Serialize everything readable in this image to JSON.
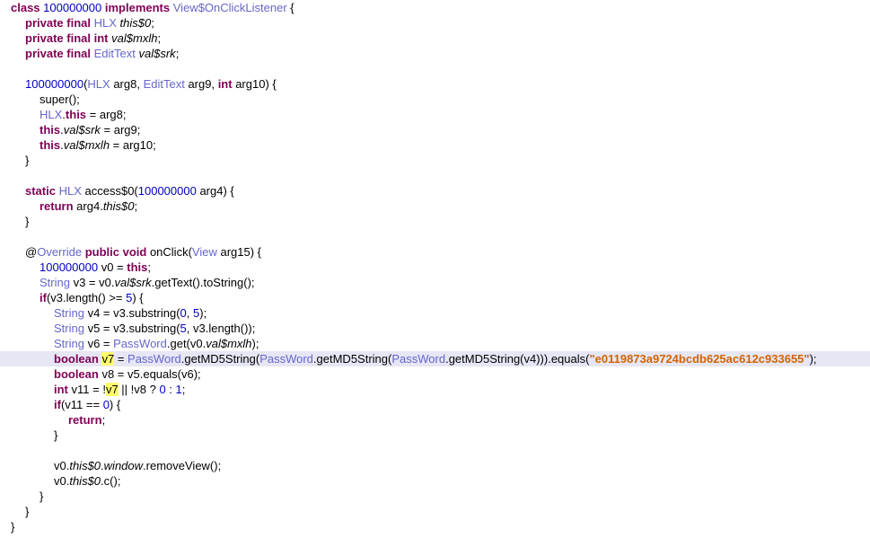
{
  "source": {
    "lines": [
      [
        {
          "t": "class",
          "c": "kw"
        },
        {
          "t": " "
        },
        {
          "t": "100000000",
          "c": "num"
        },
        {
          "t": " "
        },
        {
          "t": "implements",
          "c": "kw"
        },
        {
          "t": " "
        },
        {
          "t": "View$OnClickListener",
          "c": "ty"
        },
        {
          "t": " {"
        }
      ],
      [
        {
          "t": "private",
          "c": "kw"
        },
        {
          "t": " "
        },
        {
          "t": "final",
          "c": "kw"
        },
        {
          "t": " "
        },
        {
          "t": "HLX",
          "c": "ty"
        },
        {
          "t": " "
        },
        {
          "t": "this$0",
          "c": "it"
        },
        {
          "t": ";"
        }
      ],
      [
        {
          "t": "private",
          "c": "kw"
        },
        {
          "t": " "
        },
        {
          "t": "final",
          "c": "kw"
        },
        {
          "t": " "
        },
        {
          "t": "int",
          "c": "kw"
        },
        {
          "t": " "
        },
        {
          "t": "val$mxlh",
          "c": "it"
        },
        {
          "t": ";"
        }
      ],
      [
        {
          "t": "private",
          "c": "kw"
        },
        {
          "t": " "
        },
        {
          "t": "final",
          "c": "kw"
        },
        {
          "t": " "
        },
        {
          "t": "EditText",
          "c": "ty"
        },
        {
          "t": " "
        },
        {
          "t": "val$srk",
          "c": "it"
        },
        {
          "t": ";"
        }
      ],
      [],
      [
        {
          "t": "100000000",
          "c": "num"
        },
        {
          "t": "("
        },
        {
          "t": "HLX",
          "c": "ty"
        },
        {
          "t": " arg8, "
        },
        {
          "t": "EditText",
          "c": "ty"
        },
        {
          "t": " arg9, "
        },
        {
          "t": "int",
          "c": "kw"
        },
        {
          "t": " arg10) {"
        }
      ],
      [
        {
          "t": "super();"
        }
      ],
      [
        {
          "t": "HLX",
          "c": "ty"
        },
        {
          "t": "."
        },
        {
          "t": "this",
          "c": "kw"
        },
        {
          "t": " = arg8;"
        }
      ],
      [
        {
          "t": "this",
          "c": "kw"
        },
        {
          "t": "."
        },
        {
          "t": "val$srk",
          "c": "it"
        },
        {
          "t": " = arg9;"
        }
      ],
      [
        {
          "t": "this",
          "c": "kw"
        },
        {
          "t": "."
        },
        {
          "t": "val$mxlh",
          "c": "it"
        },
        {
          "t": " = arg10;"
        }
      ],
      [
        {
          "t": "}"
        }
      ],
      [],
      [
        {
          "t": "static",
          "c": "kw"
        },
        {
          "t": " "
        },
        {
          "t": "HLX",
          "c": "ty"
        },
        {
          "t": " access$0("
        },
        {
          "t": "100000000",
          "c": "num"
        },
        {
          "t": " arg4) {"
        }
      ],
      [
        {
          "t": "return",
          "c": "kw"
        },
        {
          "t": " arg4."
        },
        {
          "t": "this$0",
          "c": "it"
        },
        {
          "t": ";"
        }
      ],
      [
        {
          "t": "}"
        }
      ],
      [],
      [
        {
          "t": "@"
        },
        {
          "t": "Override",
          "c": "ty"
        },
        {
          "t": " "
        },
        {
          "t": "public",
          "c": "kw"
        },
        {
          "t": " "
        },
        {
          "t": "void",
          "c": "kw"
        },
        {
          "t": " onClick("
        },
        {
          "t": "View",
          "c": "ty"
        },
        {
          "t": " arg15) {"
        }
      ],
      [
        {
          "t": "100000000",
          "c": "num"
        },
        {
          "t": " v0 = "
        },
        {
          "t": "this",
          "c": "kw"
        },
        {
          "t": ";"
        }
      ],
      [
        {
          "t": "String",
          "c": "ty"
        },
        {
          "t": " v3 = v0."
        },
        {
          "t": "val$srk",
          "c": "it"
        },
        {
          "t": ".getText().toString();"
        }
      ],
      [
        {
          "t": "if",
          "c": "kw"
        },
        {
          "t": "(v3.length() >= "
        },
        {
          "t": "5",
          "c": "num"
        },
        {
          "t": ") {"
        }
      ],
      [
        {
          "t": "String",
          "c": "ty"
        },
        {
          "t": " v4 = v3.substring("
        },
        {
          "t": "0",
          "c": "num"
        },
        {
          "t": ", "
        },
        {
          "t": "5",
          "c": "num"
        },
        {
          "t": ");"
        }
      ],
      [
        {
          "t": "String",
          "c": "ty"
        },
        {
          "t": " v5 = v3.substring("
        },
        {
          "t": "5",
          "c": "num"
        },
        {
          "t": ", v3.length());"
        }
      ],
      [
        {
          "t": "String",
          "c": "ty"
        },
        {
          "t": " v6 = "
        },
        {
          "t": "PassWord",
          "c": "ty"
        },
        {
          "t": ".get(v0."
        },
        {
          "t": "val$mxlh",
          "c": "it"
        },
        {
          "t": ");"
        }
      ],
      [
        {
          "t": "boolean",
          "c": "kw"
        },
        {
          "t": " "
        },
        {
          "t": "v7",
          "c": "mk"
        },
        {
          "t": " = "
        },
        {
          "t": "PassWord",
          "c": "ty"
        },
        {
          "t": ".getMD5String("
        },
        {
          "t": "PassWord",
          "c": "ty"
        },
        {
          "t": ".getMD5String("
        },
        {
          "t": "PassWord",
          "c": "ty"
        },
        {
          "t": ".getMD5String(v4))).equals("
        },
        {
          "t": "\"e0119873a9724bcdb625ac612c933655\"",
          "c": "str"
        },
        {
          "t": ");"
        }
      ],
      [
        {
          "t": "boolean",
          "c": "kw"
        },
        {
          "t": " v8 = v5.equals(v6);"
        }
      ],
      [
        {
          "t": "int",
          "c": "kw"
        },
        {
          "t": " v11 = !"
        },
        {
          "t": "v7",
          "c": "mk"
        },
        {
          "t": " || !v8 ? "
        },
        {
          "t": "0",
          "c": "num"
        },
        {
          "t": " : "
        },
        {
          "t": "1",
          "c": "num"
        },
        {
          "t": ";"
        }
      ],
      [
        {
          "t": "if",
          "c": "kw"
        },
        {
          "t": "(v11 == "
        },
        {
          "t": "0",
          "c": "num"
        },
        {
          "t": ") {"
        }
      ],
      [
        {
          "t": "return",
          "c": "kw"
        },
        {
          "t": ";"
        }
      ],
      [
        {
          "t": "}"
        }
      ],
      [],
      [
        {
          "t": "v0."
        },
        {
          "t": "this$0",
          "c": "it"
        },
        {
          "t": "."
        },
        {
          "t": "window",
          "c": "it"
        },
        {
          "t": ".removeView();"
        }
      ],
      [
        {
          "t": "v0."
        },
        {
          "t": "this$0",
          "c": "it"
        },
        {
          "t": ".c();"
        }
      ],
      [
        {
          "t": "}"
        }
      ],
      [
        {
          "t": "}"
        }
      ],
      [
        {
          "t": "}"
        }
      ]
    ]
  }
}
